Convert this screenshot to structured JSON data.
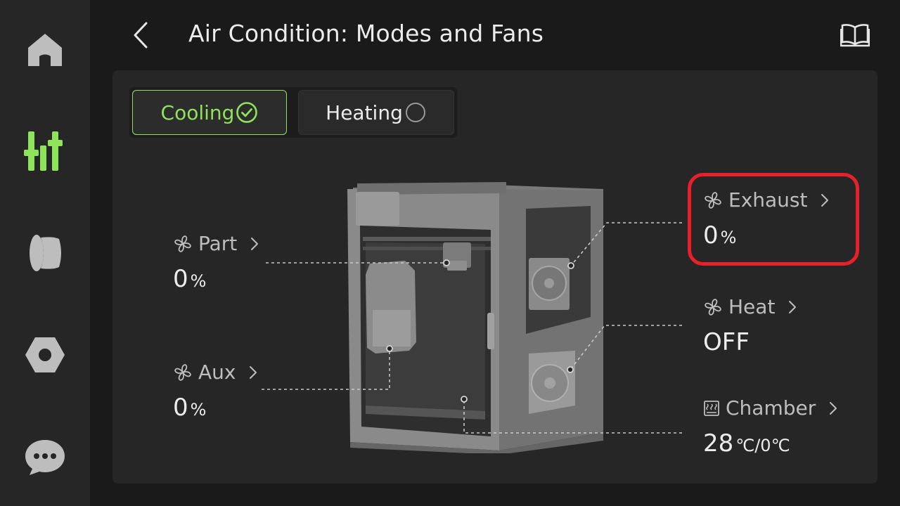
{
  "header": {
    "title": "Air Condition: Modes and Fans"
  },
  "sidebar": {
    "items": [
      {
        "icon": "home-icon"
      },
      {
        "icon": "tune-icon",
        "active": true
      },
      {
        "icon": "filament-icon"
      },
      {
        "icon": "settings-nut-icon"
      },
      {
        "icon": "chat-icon"
      }
    ]
  },
  "modes": {
    "cooling": {
      "label": "Cooling",
      "selected": true
    },
    "heating": {
      "label": "Heating",
      "selected": false
    }
  },
  "fans": {
    "part": {
      "label": "Part",
      "value": "0",
      "unit": "%"
    },
    "aux": {
      "label": "Aux",
      "value": "0",
      "unit": "%"
    },
    "exhaust": {
      "label": "Exhaust",
      "value": "0",
      "unit": "%"
    },
    "heat": {
      "label": "Heat",
      "value": "OFF"
    },
    "chamber": {
      "label": "Chamber",
      "value": "28",
      "unit": "℃/0℃"
    }
  },
  "colors": {
    "accent": "#8fe35b",
    "highlight": "#e8202a",
    "background": "#1a1a1a",
    "panel": "#262626"
  }
}
